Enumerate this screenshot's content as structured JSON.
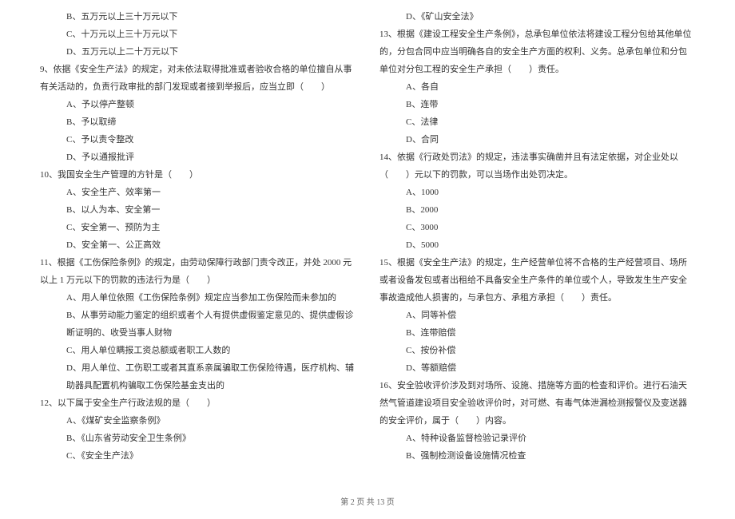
{
  "left_column": [
    {
      "type": "option",
      "text": "B、五万元以上三十万元以下"
    },
    {
      "type": "option",
      "text": "C、十万元以上三十万元以下"
    },
    {
      "type": "option",
      "text": "D、五万元以上二十万元以下"
    },
    {
      "type": "question",
      "text": "9、依据《安全生产法》的规定，对未依法取得批准或者验收合格的单位擅自从事有关活动的，负责行政审批的部门发现或者接到举报后，应当立即（　　）"
    },
    {
      "type": "option",
      "text": "A、予以停产整顿"
    },
    {
      "type": "option",
      "text": "B、予以取缔"
    },
    {
      "type": "option",
      "text": "C、予以责令整改"
    },
    {
      "type": "option",
      "text": "D、予以通报批评"
    },
    {
      "type": "question",
      "text": "10、我国安全生产管理的方针是（　　）"
    },
    {
      "type": "option",
      "text": "A、安全生产、效率第一"
    },
    {
      "type": "option",
      "text": "B、以人为本、安全第一"
    },
    {
      "type": "option",
      "text": "C、安全第一、预防为主"
    },
    {
      "type": "option",
      "text": "D、安全第一、公正高效"
    },
    {
      "type": "question",
      "text": "11、根据《工伤保险条例》的规定，由劳动保障行政部门责令改正，并处 2000 元以上 1 万元以下的罚款的违法行为是（　　）"
    },
    {
      "type": "option",
      "text": "A、用人单位依照《工伤保险条例》规定应当参加工伤保险而未参加的"
    },
    {
      "type": "option",
      "text": "B、从事劳动能力鉴定的组织或者个人有提供虚假鉴定意见的、提供虚假诊断证明的、收受当事人财物"
    },
    {
      "type": "option",
      "text": "C、用人单位瞒报工资总额或者职工人数的"
    },
    {
      "type": "option",
      "text": "D、用人单位、工伤职工或者其直系亲属骗取工伤保险待遇，医疗机构、辅助器具配置机构骗取工伤保险基金支出的"
    },
    {
      "type": "question",
      "text": "12、以下属于安全生产行政法规的是（　　）"
    },
    {
      "type": "option",
      "text": "A、《煤矿安全监察条例》"
    },
    {
      "type": "option",
      "text": "B、《山东省劳动安全卫生条例》"
    },
    {
      "type": "option",
      "text": "C、《安全生产法》"
    }
  ],
  "right_column": [
    {
      "type": "option",
      "text": "D、《矿山安全法》"
    },
    {
      "type": "question",
      "text": "13、根据《建设工程安全生产条例》，总承包单位依法将建设工程分包给其他单位的，分包合同中应当明确各自的安全生产方面的权利、义务。总承包单位和分包单位对分包工程的安全生产承担（　　）责任。"
    },
    {
      "type": "option",
      "text": "A、各自"
    },
    {
      "type": "option",
      "text": "B、连带"
    },
    {
      "type": "option",
      "text": "C、法律"
    },
    {
      "type": "option",
      "text": "D、合同"
    },
    {
      "type": "question",
      "text": "14、依据《行政处罚法》的规定，违法事实确凿并且有法定依据，对企业处以（　　）元以下的罚款，可以当场作出处罚决定。"
    },
    {
      "type": "option",
      "text": "A、1000"
    },
    {
      "type": "option",
      "text": "B、2000"
    },
    {
      "type": "option",
      "text": "C、3000"
    },
    {
      "type": "option",
      "text": "D、5000"
    },
    {
      "type": "question",
      "text": "15、根据《安全生产法》的规定，生产经营单位将不合格的生产经营项目、场所或者设备发包或者出租给不具备安全生产条件的单位或个人，导致发生生产安全事故造成他人损害的，与承包方、承租方承担（　　）责任。"
    },
    {
      "type": "option",
      "text": "A、同等补偿"
    },
    {
      "type": "option",
      "text": "B、连带赔偿"
    },
    {
      "type": "option",
      "text": "C、按份补偿"
    },
    {
      "type": "option",
      "text": "D、等额赔偿"
    },
    {
      "type": "question",
      "text": "16、安全验收评价涉及到对场所、设施、措施等方面的检查和评价。进行石油天然气管道建设项目安全验收评价时，对可燃、有毒气体泄漏检测报警仪及变送器的安全评价，属于（　　）内容。"
    },
    {
      "type": "option",
      "text": "A、特种设备监督检验记录评价"
    },
    {
      "type": "option",
      "text": "B、强制检测设备设施情况检查"
    }
  ],
  "footer": "第 2 页 共 13 页"
}
